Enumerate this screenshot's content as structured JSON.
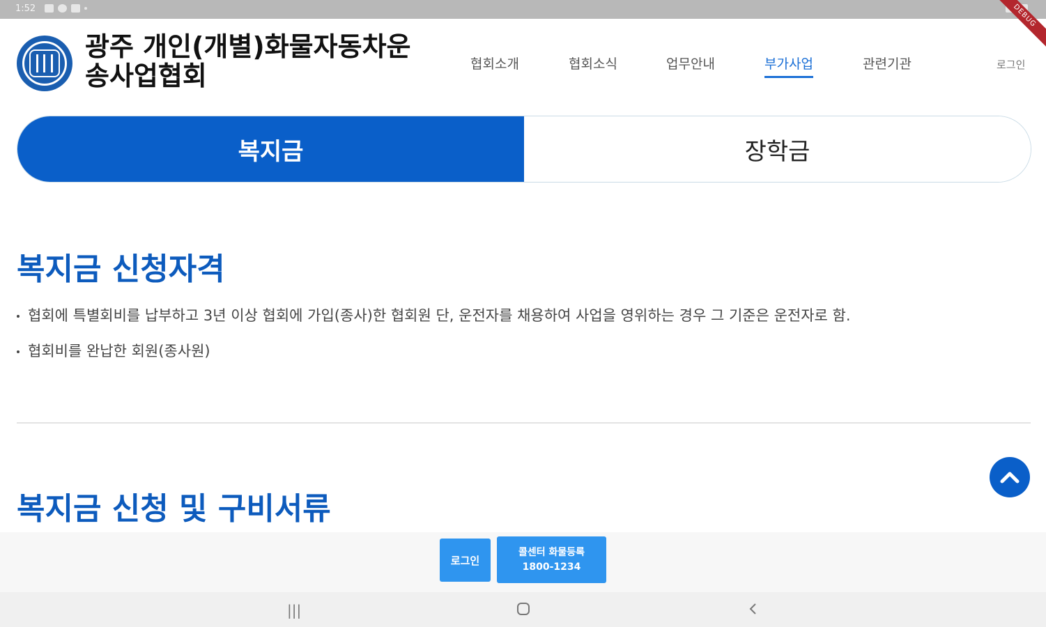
{
  "status_bar": {
    "time": "1:52"
  },
  "debug_ribbon": "DEBUG",
  "header": {
    "org_title_line1": "광주 개인(개별)화물자동차운",
    "org_title_line2": "송사업협회",
    "nav": [
      {
        "label": "협회소개",
        "active": false
      },
      {
        "label": "협회소식",
        "active": false
      },
      {
        "label": "업무안내",
        "active": false
      },
      {
        "label": "부가사업",
        "active": true
      },
      {
        "label": "관련기관",
        "active": false
      }
    ],
    "login": "로그인"
  },
  "tabs": {
    "active": "복지금",
    "inactive": "장학금"
  },
  "sections": {
    "qualification_title": "복지금 신청자격",
    "bullets": [
      "협회에 특별회비를 납부하고 3년 이상 협회에 가입(종사)한 협회원 단, 운전자를 채용하여 사업을 영위하는 경우 그 기준은 운전자로 함.",
      "협회비를 완납한 회원(종사원)"
    ],
    "documents_title": "복지금 신청 및 구비서류"
  },
  "bottom": {
    "login_button": "로그인",
    "call_button_line1": "콜센터 화물등록",
    "call_button_line2": "1800-1234"
  },
  "colors": {
    "accent": "#0a5fc9",
    "button": "#2f95ef"
  }
}
